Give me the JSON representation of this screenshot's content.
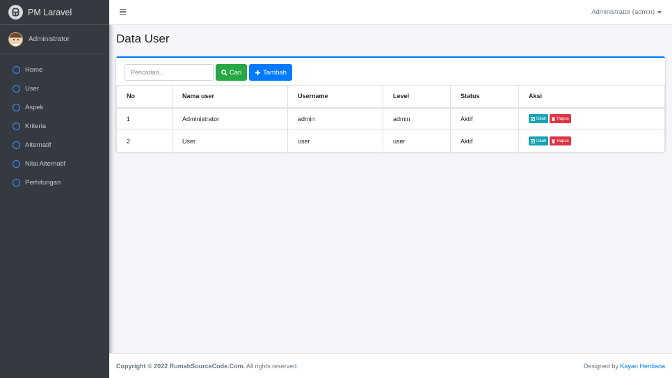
{
  "app": {
    "brand": "PM Laravel"
  },
  "sidebar": {
    "user_name": "Administrator",
    "items": [
      {
        "label": "Home"
      },
      {
        "label": "User"
      },
      {
        "label": "Aspek"
      },
      {
        "label": "Kriteria"
      },
      {
        "label": "Alternatif"
      },
      {
        "label": "Nilai Alternatif"
      },
      {
        "label": "Perhitungan"
      }
    ],
    "icon": "circle-outline-icon",
    "accent": "#3f8eff"
  },
  "topbar": {
    "user_menu": "Administrator (admin)"
  },
  "page": {
    "title": "Data User"
  },
  "toolbar": {
    "search_placeholder": "Pencarian...",
    "search_value": "",
    "cari_label": "Cari",
    "tambah_label": "Tambah"
  },
  "table": {
    "headers": {
      "no": "No",
      "nama": "Nama user",
      "username": "Username",
      "level": "Level",
      "status": "Status",
      "aksi": "Aksi"
    },
    "rows": [
      {
        "no": "1",
        "nama": "Administrator",
        "username": "admin",
        "level": "admin",
        "status": "Aktif",
        "ubah": "Ubah",
        "hapus": "Hapus"
      },
      {
        "no": "2",
        "nama": "User",
        "username": "user",
        "level": "user",
        "status": "Aktif",
        "ubah": "Ubah",
        "hapus": "Hapus"
      }
    ]
  },
  "footer": {
    "copyright": "Copyright © 2022 RumahSourceCode.Com.",
    "rights": " All rights reserved.",
    "designed_by": "Designed by ",
    "designer": "Kayan Herdiana"
  },
  "colors": {
    "primary": "#007bff",
    "success": "#28a745",
    "info": "#17a2b8",
    "danger": "#dc3545",
    "sidebar_bg": "#343a40"
  }
}
